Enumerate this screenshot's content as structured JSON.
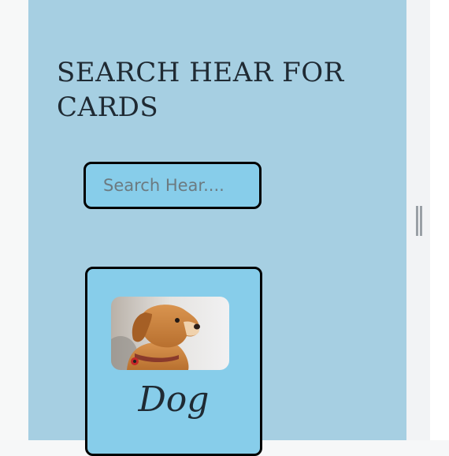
{
  "header": {
    "title": "SEARCH HEAR FOR CARDS"
  },
  "search": {
    "placeholder": "Search Hear...."
  },
  "cards": [
    {
      "title": "Dog",
      "image_icon": "dog-photo"
    }
  ],
  "colors": {
    "panel_background": "#a6cfe2",
    "card_background": "#87cdea",
    "border": "#000000",
    "text": "#1f2a33"
  }
}
